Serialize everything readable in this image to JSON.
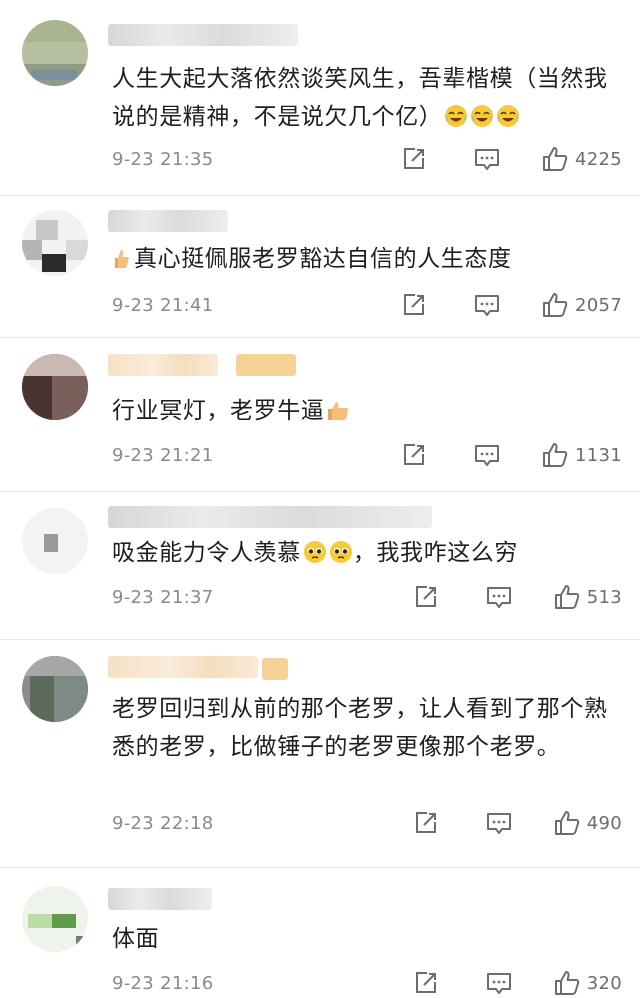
{
  "comments": [
    {
      "text": "人生大起大落依然谈笑风生，吾辈楷模（当然我说的是精神，不是说欠几个亿）",
      "emoji": [
        "crying-laughing-emoji",
        "crying-laughing-emoji",
        "crying-laughing-emoji"
      ],
      "time": "9-23 21:35",
      "likes": "4225"
    },
    {
      "text": "真心挺佩服老罗豁达自信的人生态度",
      "prefix_emoji": "thumbs-up-emoji",
      "time": "9-23 21:41",
      "likes": "2057"
    },
    {
      "text": "行业冥灯，老罗牛逼",
      "emoji": [
        "thumbs-up-emoji"
      ],
      "time": "9-23 21:21",
      "likes": "1131"
    },
    {
      "text_before_emoji": "吸金能力令人羡慕",
      "text_after_emoji": "，我我咋这么穷",
      "emoji": [
        "pleading-face-emoji",
        "pleading-face-emoji"
      ],
      "time": "9-23 21:37",
      "likes": "513"
    },
    {
      "text": "老罗回归到从前的那个老罗，让人看到了那个熟悉的老罗，比做锤子的老罗更像那个老罗。",
      "time": "9-23 22:18",
      "likes": "490"
    },
    {
      "text": "体面",
      "time": "9-23 21:16",
      "likes": "320"
    }
  ],
  "icons": {
    "repost": "repost-icon",
    "comment": "comment-icon",
    "like": "like-icon"
  },
  "colors": {
    "time": "#8a8a8a",
    "icon": "#6d6d6d",
    "divider": "#e9e9e9"
  }
}
